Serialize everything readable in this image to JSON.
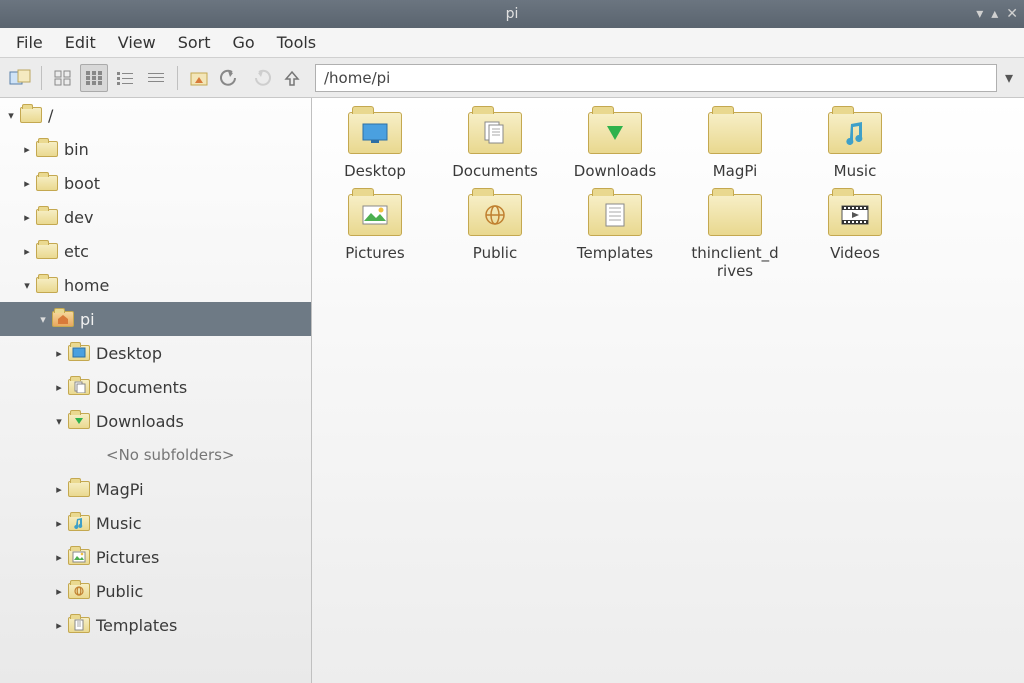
{
  "window": {
    "title": "pi"
  },
  "menu": {
    "file": "File",
    "edit": "Edit",
    "view": "View",
    "sort": "Sort",
    "go": "Go",
    "tools": "Tools"
  },
  "path": {
    "value": "/home/pi"
  },
  "tree": {
    "root": "/",
    "bin": "bin",
    "boot": "boot",
    "dev": "dev",
    "etc": "etc",
    "home": "home",
    "pi": "pi",
    "desktop": "Desktop",
    "documents": "Documents",
    "downloads": "Downloads",
    "nosub": "<No subfolders>",
    "magpi": "MagPi",
    "music": "Music",
    "pictures": "Pictures",
    "public": "Public",
    "templates": "Templates"
  },
  "items": {
    "desktop": "Desktop",
    "documents": "Documents",
    "downloads": "Downloads",
    "magpi": "MagPi",
    "music": "Music",
    "pictures": "Pictures",
    "public": "Public",
    "templates": "Templates",
    "thinclient": "thinclient_drives",
    "videos": "Videos"
  }
}
